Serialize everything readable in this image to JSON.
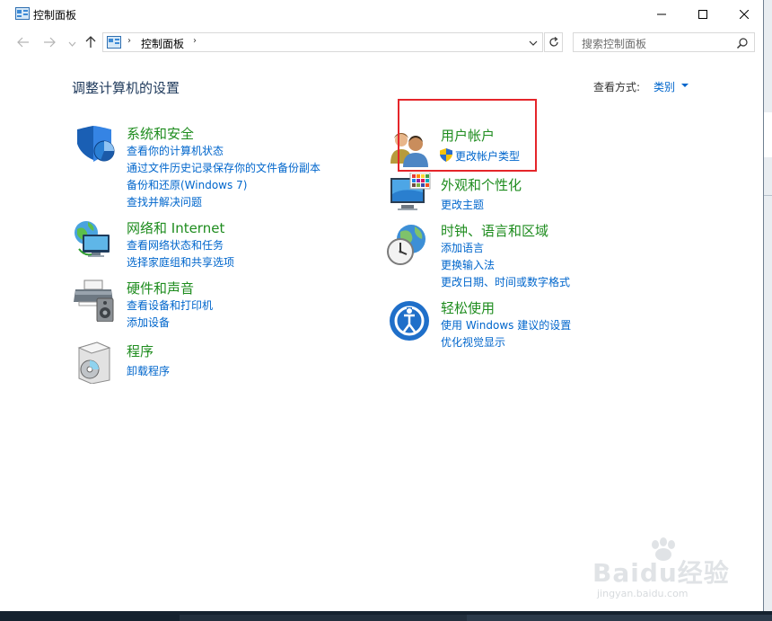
{
  "window": {
    "title": "控制面板"
  },
  "address_bar": {
    "breadcrumb": "控制面板",
    "separator": "›"
  },
  "search": {
    "placeholder": "搜索控制面板"
  },
  "main": {
    "heading": "调整计算机的设置",
    "view_by_label": "查看方式:",
    "view_by_value": "类别"
  },
  "categories": {
    "system_security": {
      "title": "系统和安全",
      "icon": "shield-icon",
      "links": [
        "查看你的计算机状态",
        "通过文件历史记录保存你的文件备份副本",
        "备份和还原(Windows 7)",
        "查找并解决问题"
      ]
    },
    "network": {
      "title": "网络和 Internet",
      "icon": "network-globe-icon",
      "links": [
        "查看网络状态和任务",
        "选择家庭组和共享选项"
      ]
    },
    "hardware": {
      "title": "硬件和声音",
      "icon": "printer-speaker-icon",
      "links": [
        "查看设备和打印机",
        "添加设备"
      ]
    },
    "programs": {
      "title": "程序",
      "icon": "programs-disc-icon",
      "links": [
        "卸载程序"
      ]
    },
    "user_accounts": {
      "title": "用户帐户",
      "icon": "users-icon",
      "links": [
        "更改帐户类型"
      ]
    },
    "appearance": {
      "title": "外观和个性化",
      "icon": "monitor-palette-icon",
      "links": [
        "更改主题"
      ]
    },
    "clock_region": {
      "title": "时钟、语言和区域",
      "icon": "clock-globe-icon",
      "links": [
        "添加语言",
        "更换输入法",
        "更改日期、时间或数字格式"
      ]
    },
    "ease_of_access": {
      "title": "轻松使用",
      "icon": "ease-of-access-icon",
      "links": [
        "使用 Windows 建议的设置",
        "优化视觉显示"
      ]
    }
  },
  "watermark": {
    "brand": "Baidu经验",
    "url": "jingyan.baidu.com"
  },
  "colors": {
    "category_title": "#1e8c1e",
    "link": "#0066cc",
    "heading": "#1e395b",
    "highlight": "#e5252a"
  }
}
